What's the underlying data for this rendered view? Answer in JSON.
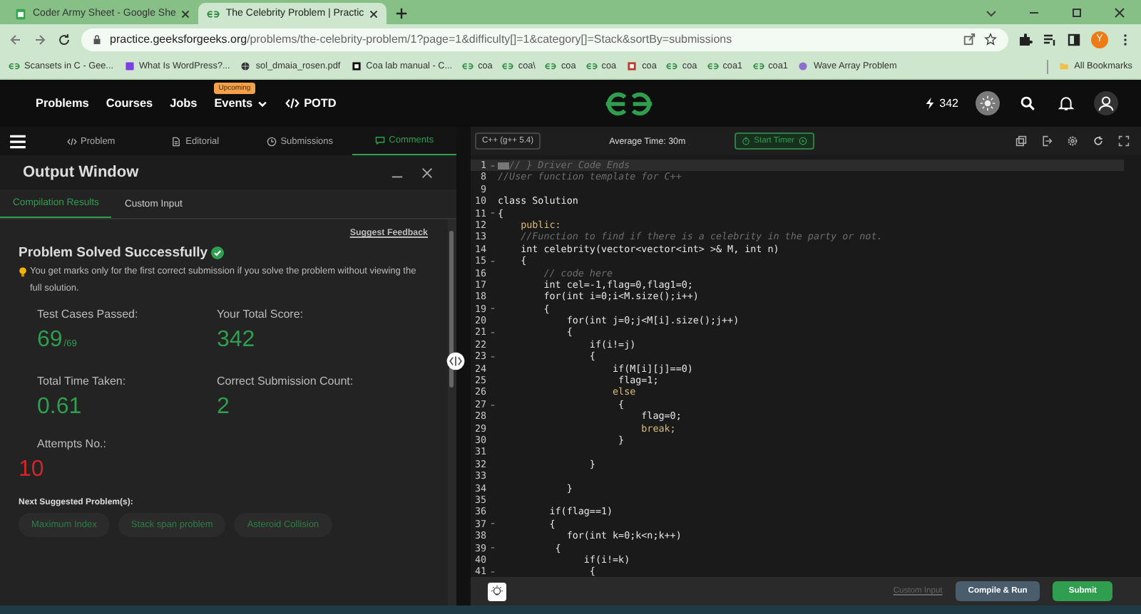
{
  "browser": {
    "tabs": [
      {
        "title": "Coder Army Sheet - Google She",
        "kind": "sheet",
        "selected": false
      },
      {
        "title": "The Celebrity Problem | Practic",
        "kind": "gfg",
        "selected": true
      }
    ],
    "url": {
      "domain": "practice.geeksforgeeks.org",
      "path": "/problems/the-celebrity-problem/1?page=1&difficulty[]=1&category[]=Stack&sortBy=submissions"
    },
    "profile": "Y",
    "bookmarks": [
      {
        "label": "Scansets in C - Gee...",
        "kind": "gfg"
      },
      {
        "label": "What Is WordPress?...",
        "kind": "square"
      },
      {
        "label": "sol_dmaia_rosen.pdf",
        "kind": "globe"
      },
      {
        "label": "Coa lab manual - C...",
        "kind": "page"
      },
      {
        "label": "coa",
        "kind": "gfg"
      },
      {
        "label": "coa\\",
        "kind": "gfg"
      },
      {
        "label": "coa",
        "kind": "gfg"
      },
      {
        "label": "coa",
        "kind": "gfg"
      },
      {
        "label": "coa",
        "kind": "tile"
      },
      {
        "label": "coa",
        "kind": "gfg"
      },
      {
        "label": "coa1",
        "kind": "gfg"
      },
      {
        "label": "coa1",
        "kind": "gfg"
      },
      {
        "label": "Wave Array Problem",
        "kind": "dot"
      }
    ],
    "all_bookmarks": "All Bookmarks"
  },
  "site_nav": {
    "items": [
      {
        "label": "Problems"
      },
      {
        "label": "Courses"
      },
      {
        "label": "Jobs"
      },
      {
        "label": "Events",
        "badge": "Upcoming",
        "dropdown": true
      },
      {
        "label": "POTD",
        "kind": "code"
      }
    ],
    "streak": "342"
  },
  "problem_tabs": [
    {
      "label": "Problem",
      "kind": "code",
      "selected": false
    },
    {
      "label": "Editorial",
      "kind": "doc",
      "selected": false
    },
    {
      "label": "Submissions",
      "kind": "clock",
      "selected": false
    },
    {
      "label": "Comments",
      "kind": "chat",
      "selected": true
    }
  ],
  "output_window": {
    "title": "Output Window",
    "tabs": [
      {
        "label": "Compilation Results",
        "selected": true
      },
      {
        "label": "Custom Input",
        "selected": false
      }
    ],
    "feedback": "Suggest Feedback",
    "status": "Problem Solved Successfully",
    "note": "You get marks only for the first correct submission if you solve the problem without viewing the full solution.",
    "stats": [
      {
        "label": "Test Cases Passed:",
        "value": "69",
        "suffix": "/69",
        "kind": "success"
      },
      {
        "label": "Your Total Score:",
        "value": "342",
        "kind": "success"
      },
      {
        "label": "Total Time Taken:",
        "value": "0.61",
        "kind": "success"
      },
      {
        "label": "Correct Submission Count:",
        "value": "2",
        "kind": "success"
      },
      {
        "label": "Attempts No.:",
        "value": "10",
        "kind": "danger"
      }
    ],
    "next_title": "Next Suggested Problem(s):",
    "suggestions": [
      "Maximum Index",
      "Stack span problem",
      "Asteroid Collision"
    ]
  },
  "editor": {
    "language": "C++ (g++ 5.4)",
    "average_time": "Average Time: 30m",
    "timer": "Start Timer",
    "lines": [
      {
        "n": "1",
        "text": "// } Driver Code Ends",
        "kind": "comment",
        "fold": true,
        "highlight": true
      },
      {
        "n": "8",
        "text": "//User function template for C++",
        "kind": "comment"
      },
      {
        "n": "9"
      },
      {
        "n": "10",
        "text": "class Solution",
        "kind": "code"
      },
      {
        "n": "11",
        "text": "{",
        "kind": "code",
        "fold": true
      },
      {
        "n": "12",
        "text": "    public:",
        "kind": "keyword"
      },
      {
        "n": "13",
        "text": "    //Function to find if there is a celebrity in the party or not.",
        "kind": "comment"
      },
      {
        "n": "14",
        "text": "    int celebrity(vector<vector<int> >& M, int n)",
        "kind": "code"
      },
      {
        "n": "15",
        "text": "    {",
        "kind": "code",
        "fold": true
      },
      {
        "n": "16",
        "text": "        // code here",
        "kind": "comment"
      },
      {
        "n": "17",
        "text": "        int cel=-1,flag=0,flag1=0;",
        "kind": "code"
      },
      {
        "n": "18",
        "text": "        for(int i=0;i<M.size();i++)",
        "kind": "code"
      },
      {
        "n": "19",
        "text": "        {",
        "kind": "code",
        "fold": true
      },
      {
        "n": "20",
        "text": "            for(int j=0;j<M[i].size();j++)",
        "kind": "code"
      },
      {
        "n": "21",
        "text": "            {",
        "kind": "code",
        "fold": true
      },
      {
        "n": "22",
        "text": "                if(i!=j)",
        "kind": "code"
      },
      {
        "n": "23",
        "text": "                {",
        "kind": "code",
        "fold": true
      },
      {
        "n": "24",
        "text": "                    if(M[i][j]==0)",
        "kind": "code"
      },
      {
        "n": "25",
        "text": "                     flag=1;",
        "kind": "code"
      },
      {
        "n": "26",
        "text": "                    else",
        "kind": "keyword"
      },
      {
        "n": "27",
        "text": "                     {",
        "kind": "code",
        "fold": true
      },
      {
        "n": "28",
        "text": "                         flag=0;",
        "kind": "code"
      },
      {
        "n": "29",
        "text": "                         break;",
        "kind": "keyword"
      },
      {
        "n": "30",
        "text": "                     }",
        "kind": "code"
      },
      {
        "n": "31"
      },
      {
        "n": "32",
        "text": "                }",
        "kind": "code"
      },
      {
        "n": "33"
      },
      {
        "n": "34",
        "text": "            }",
        "kind": "code"
      },
      {
        "n": "35"
      },
      {
        "n": "36",
        "text": "         if(flag==1)",
        "kind": "code"
      },
      {
        "n": "37",
        "text": "         {",
        "kind": "code",
        "fold": true
      },
      {
        "n": "38",
        "text": "            for(int k=0;k<n;k++)",
        "kind": "code"
      },
      {
        "n": "39",
        "text": "          {",
        "kind": "code",
        "fold": true
      },
      {
        "n": "40",
        "text": "               if(i!=k)",
        "kind": "code"
      },
      {
        "n": "41",
        "text": "                {",
        "kind": "code",
        "fold": true
      }
    ],
    "custom_input": "Custom Input",
    "compile": "Compile & Run",
    "submit": "Submit"
  }
}
